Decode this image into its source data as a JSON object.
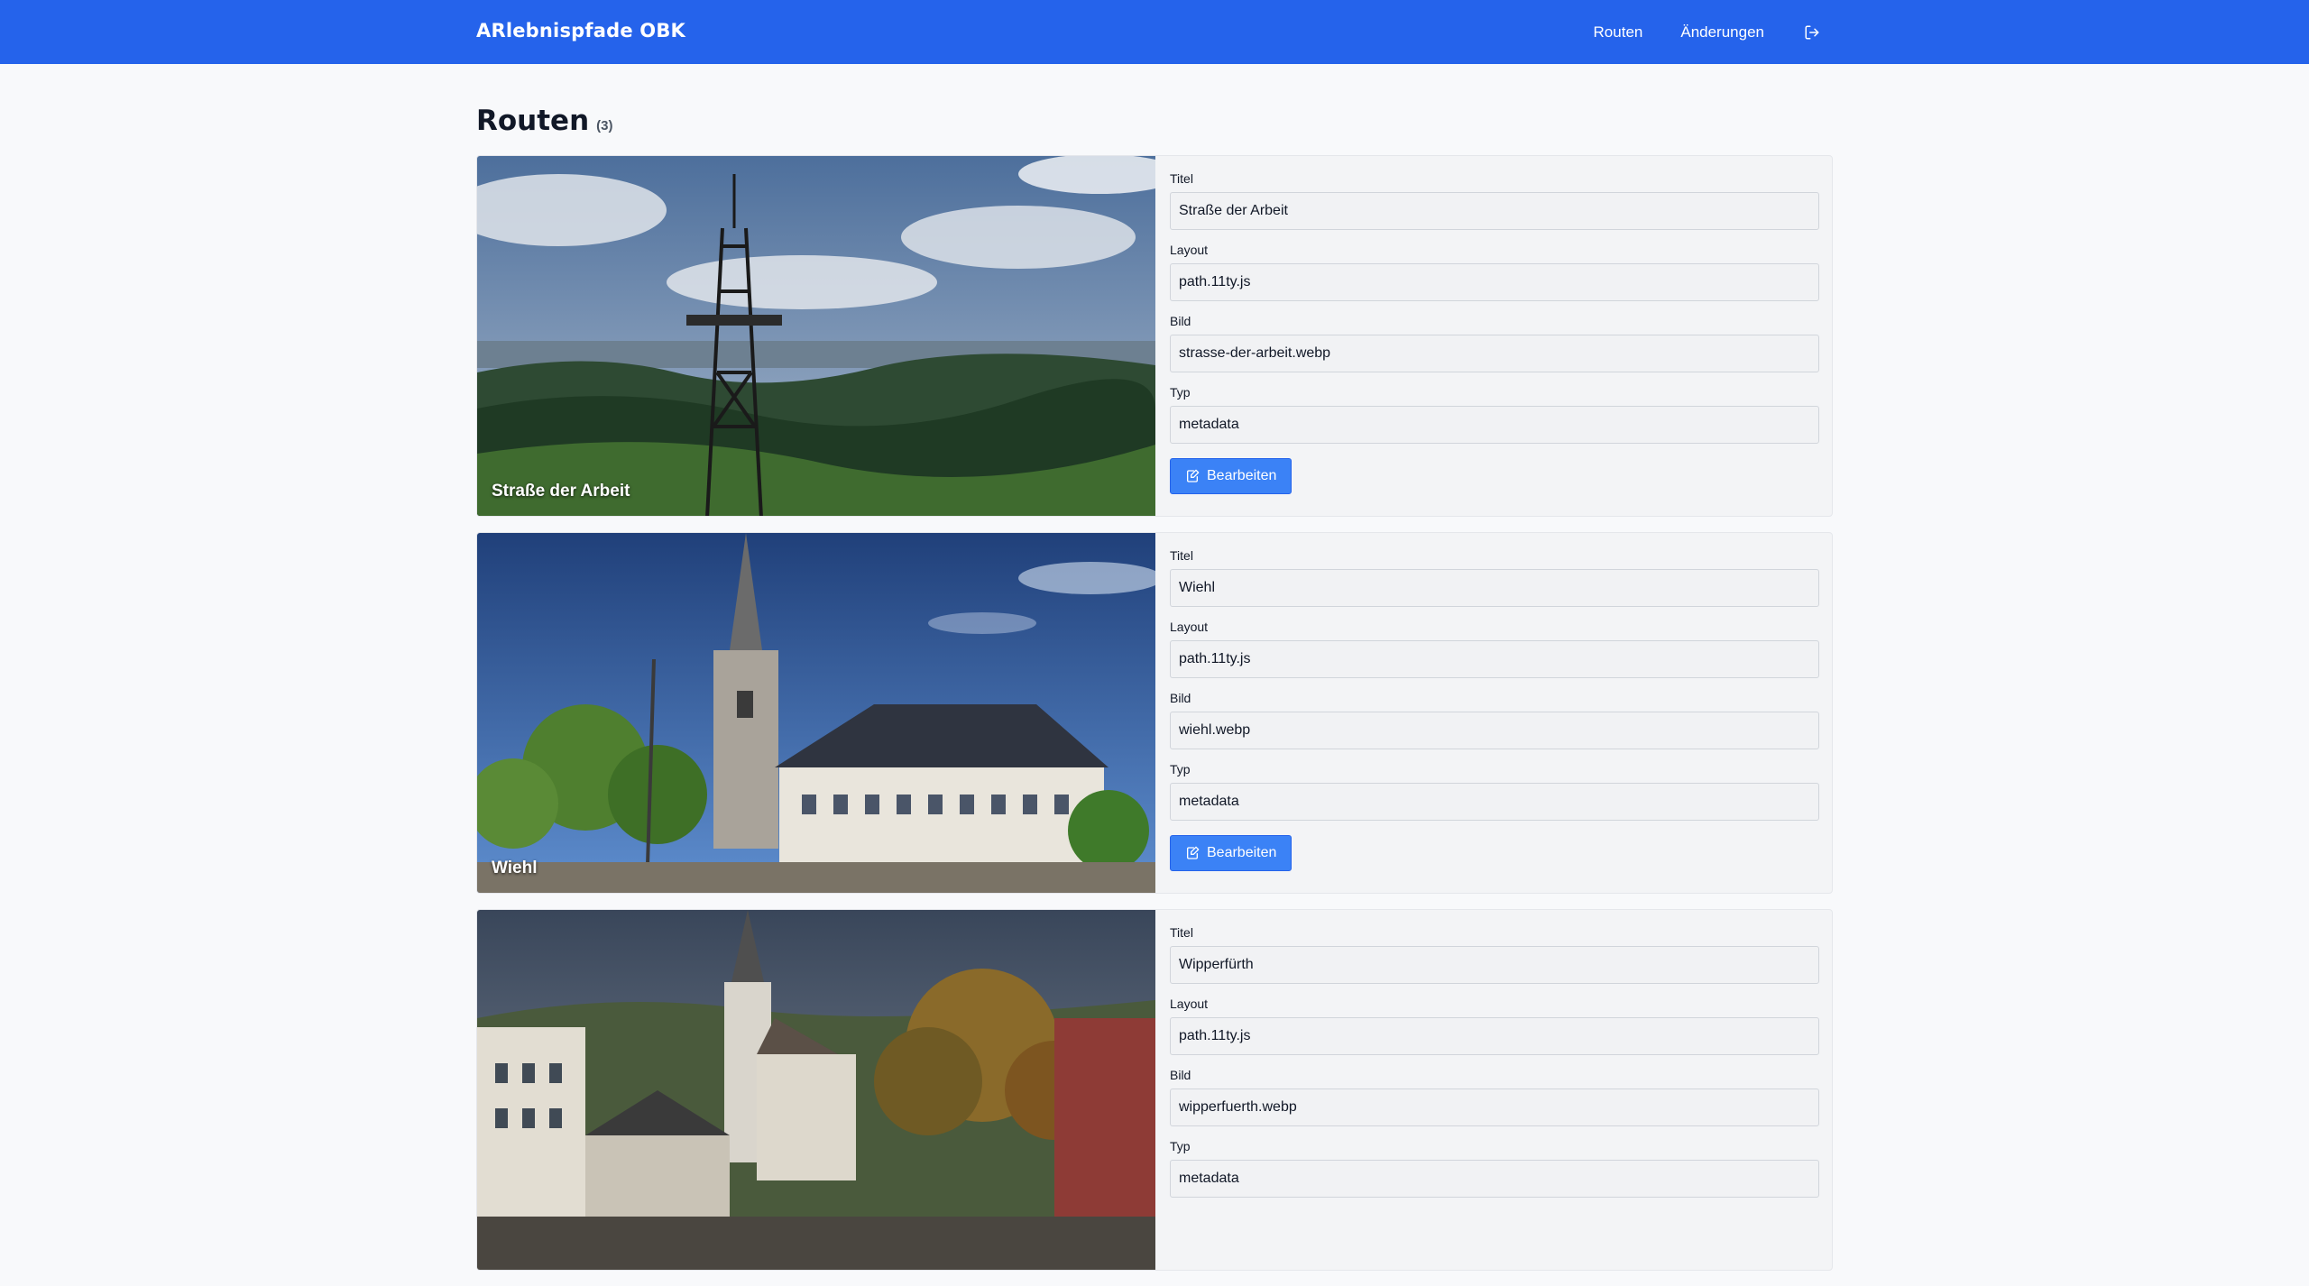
{
  "app": {
    "title": "ARlebnispfade OBK"
  },
  "nav": {
    "routes": "Routen",
    "changes": "Änderungen",
    "logout_icon": "logout-icon"
  },
  "page": {
    "heading": "Routen",
    "count": "(3)"
  },
  "labels": {
    "title": "Titel",
    "layout": "Layout",
    "image": "Bild",
    "type": "Typ",
    "edit": "Bearbeiten"
  },
  "routes": [
    {
      "caption": "Straße der Arbeit",
      "title": "Straße der Arbeit",
      "layout": "path.11ty.js",
      "image": "strasse-der-arbeit.webp",
      "type": "metadata",
      "scene": "tower-forest"
    },
    {
      "caption": "Wiehl",
      "title": "Wiehl",
      "layout": "path.11ty.js",
      "image": "wiehl.webp",
      "type": "metadata",
      "scene": "church-town"
    },
    {
      "caption": "",
      "title": "Wipperfürth",
      "layout": "path.11ty.js",
      "image": "wipperfuerth.webp",
      "type": "metadata",
      "scene": "church-market"
    }
  ],
  "colors": {
    "brand": "#2563eb",
    "button": "#3b82f6"
  }
}
